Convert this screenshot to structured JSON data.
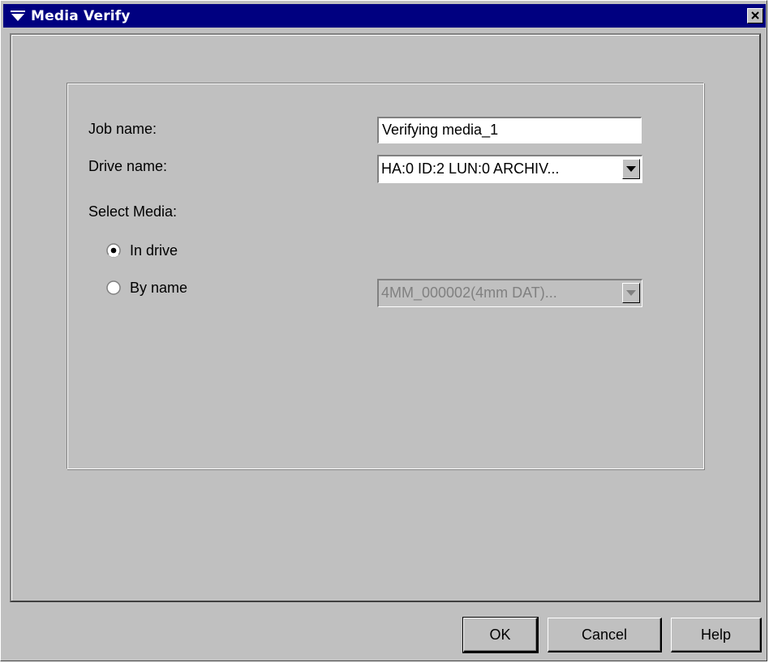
{
  "window": {
    "title": "Media Verify",
    "close_glyph": "×"
  },
  "form": {
    "job_name_label": "Job name:",
    "job_name_value": "Verifying media_1",
    "drive_name_label": "Drive name:",
    "drive_name_value": "HA:0 ID:2 LUN:0 ARCHIV...",
    "select_media_label": "Select Media:",
    "radio_in_drive_label": "In drive",
    "radio_in_drive_checked": true,
    "radio_by_name_label": "By name",
    "radio_by_name_checked": false,
    "media_name_value": "4MM_000002(4mm DAT)...",
    "media_name_enabled": false
  },
  "buttons": {
    "ok": "OK",
    "cancel": "Cancel",
    "help": "Help"
  },
  "colors": {
    "titlebar": "#000080",
    "face": "#c0c0c0",
    "disabled_text": "#808080"
  },
  "icons": [
    "window-menu-icon",
    "close-icon",
    "chevron-down-icon",
    "radio-checked-icon",
    "radio-unchecked-icon"
  ]
}
